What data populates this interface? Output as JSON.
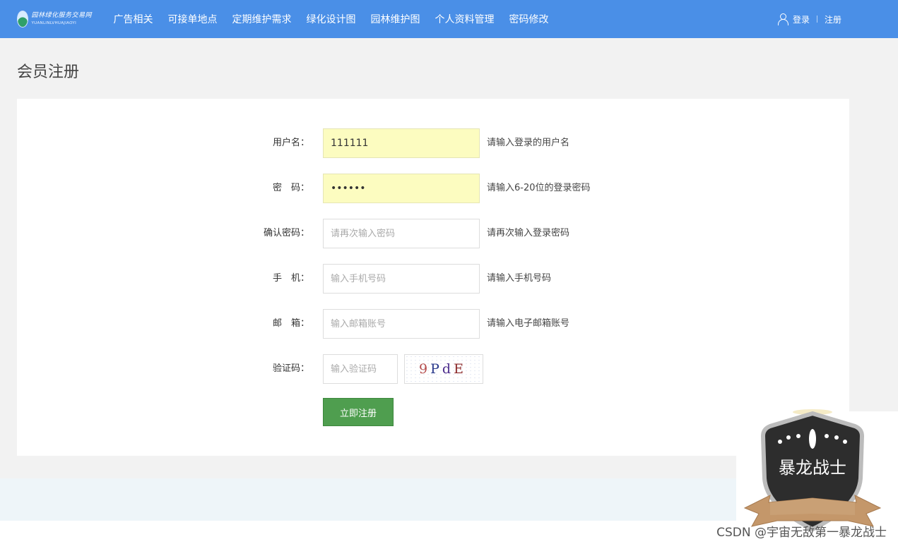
{
  "header": {
    "logo_cn": "园林绿化服务交易网",
    "logo_en": "YUANLINLVHUAJIAOYI",
    "nav": [
      "广告相关",
      "可接单地点",
      "定期维护需求",
      "绿化设计图",
      "园林维护图",
      "个人资料管理",
      "密码修改"
    ],
    "login": "登录",
    "register": "注册"
  },
  "page": {
    "title": "会员注册"
  },
  "form": {
    "username": {
      "label": "用户名：",
      "value": "111111",
      "hint": "请输入登录的用户名"
    },
    "password": {
      "label": "密　码：",
      "value": "111111",
      "hint": "请输入6-20位的登录密码"
    },
    "confirm": {
      "label": "确认密码：",
      "placeholder": "请再次输入密码",
      "hint": "请再次输入登录密码"
    },
    "phone": {
      "label": "手　机：",
      "placeholder": "输入手机号码",
      "hint": "请输入手机号码"
    },
    "email": {
      "label": "邮　箱：",
      "placeholder": "输入邮箱账号",
      "hint": "请输入电子邮箱账号"
    },
    "captcha": {
      "label": "验证码：",
      "placeholder": "输入验证码",
      "chars": [
        "9",
        "P",
        "d",
        "E"
      ]
    },
    "submit": "立即注册"
  },
  "watermark": {
    "badge_text": "暴龙战士",
    "caption": "CSDN @宇宙无敌第一暴龙战士"
  },
  "colors": {
    "header": "#4a8fe7",
    "submit": "#4f9e4f",
    "autofill": "#fcfcc0"
  }
}
